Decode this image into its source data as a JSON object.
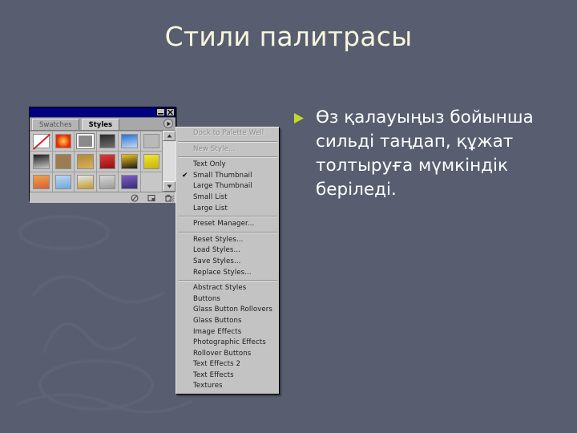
{
  "slide": {
    "title": "Стили палитрасы",
    "title_color": "#f7f6dc",
    "background_color": "#585e70"
  },
  "body": {
    "bullet_marker": "triangle-right-bullet",
    "bullet_color": "#c3d82e",
    "text": "Өз қалауыңыз бойынша сильді таңдап, құжат толтыруға мүмкіндік беріледі.",
    "text_color": "#ffffff"
  },
  "palette": {
    "titlebar": {
      "color": "#000080",
      "minimize_label": "_",
      "close_label": "×"
    },
    "tabs": [
      {
        "label": "Swatches",
        "active": false
      },
      {
        "label": "Styles",
        "active": true
      }
    ],
    "menu_arrow_icon": "palette-menu-arrow-icon",
    "swatches": [
      {
        "name": "none-style",
        "type": "none",
        "color": "#ffffff"
      },
      {
        "name": "red-glow",
        "type": "radial",
        "color": "#e62a00",
        "color2": "#ffd24d"
      },
      {
        "name": "gray-plain",
        "type": "flat",
        "color": "#8a8a8a"
      },
      {
        "name": "dark-texture",
        "type": "linear",
        "color": "#2b2b2b",
        "color2": "#6e6e6e"
      },
      {
        "name": "blue-shape",
        "type": "linear",
        "color": "#2f6fd0",
        "color2": "#bcd8f7"
      },
      {
        "name": "light-gray",
        "type": "flat",
        "color": "#b9b9b9"
      },
      {
        "name": "dark-gradient",
        "type": "linear",
        "color": "#1e1e1e",
        "color2": "#c8c8c8"
      },
      {
        "name": "tan-flat",
        "type": "flat",
        "color": "#9c7d52"
      },
      {
        "name": "gold-gradient",
        "type": "linear",
        "color": "#b08a37",
        "color2": "#d8b05c"
      },
      {
        "name": "red-stripe",
        "type": "linear",
        "color": "#e23a3a",
        "color2": "#8d1212"
      },
      {
        "name": "black-yellow-graphic",
        "type": "linear",
        "color": "#f2c21b",
        "color2": "#1b1b1b"
      },
      {
        "name": "yellow-crumple",
        "type": "linear",
        "color": "#f3e431",
        "color2": "#c7b50d"
      },
      {
        "name": "orange-gradient",
        "type": "linear",
        "color": "#f0a24a",
        "color2": "#d8603a"
      },
      {
        "name": "light-blue-gradient",
        "type": "linear",
        "color": "#bcd9f2",
        "color2": "#6ea8da"
      },
      {
        "name": "gold-blue-band",
        "type": "linear",
        "color": "#dfe8f2",
        "color2": "#c79a22"
      },
      {
        "name": "gray-pattern",
        "type": "linear",
        "color": "#d8d8d8",
        "color2": "#9a9a9a"
      },
      {
        "name": "purple-gradient",
        "type": "linear",
        "color": "#7d5ec9",
        "color2": "#3b2a72"
      },
      {
        "name": "empty-slot",
        "type": "empty",
        "color": "#c7c7c7"
      }
    ],
    "scroll_up_icon": "scroll-up-arrow-icon",
    "scroll_down_icon": "scroll-down-arrow-icon",
    "footer_icons": [
      "no-entry-icon",
      "new-style-icon",
      "trash-icon"
    ],
    "resize_grip_icon": "resize-grip-icon"
  },
  "menu": {
    "groups": [
      {
        "items": [
          {
            "label": "Dock to Palette Well",
            "disabled": true,
            "checked": false
          }
        ]
      },
      {
        "items": [
          {
            "label": "New Style...",
            "disabled": true,
            "checked": false
          }
        ]
      },
      {
        "items": [
          {
            "label": "Text Only",
            "disabled": false,
            "checked": false
          },
          {
            "label": "Small Thumbnail",
            "disabled": false,
            "checked": true
          },
          {
            "label": "Large Thumbnail",
            "disabled": false,
            "checked": false
          },
          {
            "label": "Small List",
            "disabled": false,
            "checked": false
          },
          {
            "label": "Large List",
            "disabled": false,
            "checked": false
          }
        ]
      },
      {
        "items": [
          {
            "label": "Preset Manager...",
            "disabled": false,
            "checked": false
          }
        ]
      },
      {
        "items": [
          {
            "label": "Reset Styles...",
            "disabled": false,
            "checked": false
          },
          {
            "label": "Load Styles...",
            "disabled": false,
            "checked": false
          },
          {
            "label": "Save Styles...",
            "disabled": false,
            "checked": false
          },
          {
            "label": "Replace Styles...",
            "disabled": false,
            "checked": false
          }
        ]
      },
      {
        "items": [
          {
            "label": "Abstract Styles",
            "disabled": false,
            "checked": false
          },
          {
            "label": "Buttons",
            "disabled": false,
            "checked": false
          },
          {
            "label": "Glass Button Rollovers",
            "disabled": false,
            "checked": false
          },
          {
            "label": "Glass Buttons",
            "disabled": false,
            "checked": false
          },
          {
            "label": "Image Effects",
            "disabled": false,
            "checked": false
          },
          {
            "label": "Photographic Effects",
            "disabled": false,
            "checked": false
          },
          {
            "label": "Rollover Buttons",
            "disabled": false,
            "checked": false
          },
          {
            "label": "Text Effects 2",
            "disabled": false,
            "checked": false
          },
          {
            "label": "Text Effects",
            "disabled": false,
            "checked": false
          },
          {
            "label": "Textures",
            "disabled": false,
            "checked": false
          }
        ]
      }
    ],
    "check_glyph": "✔"
  }
}
